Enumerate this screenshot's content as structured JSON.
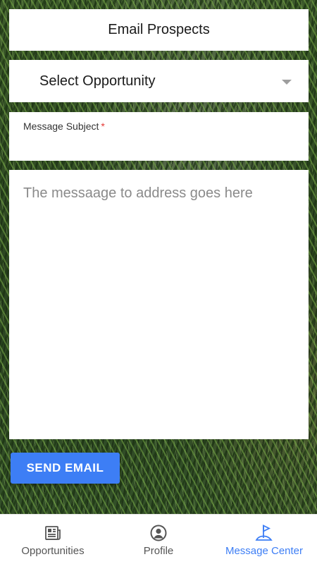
{
  "header": {
    "title": "Email Prospects"
  },
  "opportunity_select": {
    "selected_label": "Select Opportunity"
  },
  "subject": {
    "label": "Message Subject",
    "required_mark": "*",
    "value": ""
  },
  "message": {
    "placeholder": "The messaage to address goes here",
    "value": ""
  },
  "actions": {
    "send_label": "SEND EMAIL"
  },
  "tabbar": {
    "active_color": "#3d7ef5",
    "items": [
      {
        "label": "Opportunities",
        "icon": "newspaper-icon",
        "active": false
      },
      {
        "label": "Profile",
        "icon": "user-circle-icon",
        "active": false
      },
      {
        "label": "Message Center",
        "icon": "flag-icon",
        "active": true
      }
    ]
  }
}
